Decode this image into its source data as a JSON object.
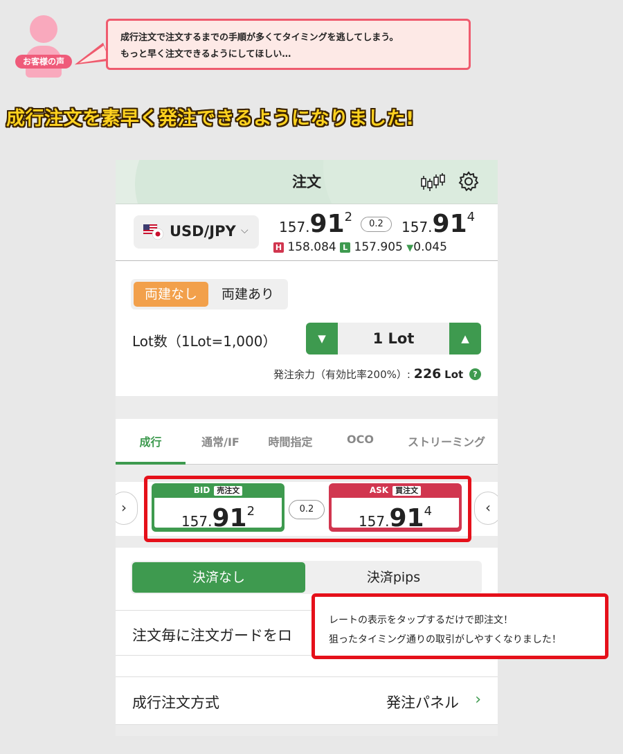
{
  "voice": {
    "badge": "お客様の声",
    "line1": "成行注文で注文するまでの手順が多くてタイミングを逃してしまう。",
    "line2": "もっと早く注文できるようにしてほしい…"
  },
  "headline": "成行注文を素早く発注できるようになりました!",
  "app": {
    "title": "注文",
    "chart_icon": "candlestick-icon",
    "settings_icon": "gear-icon"
  },
  "rate": {
    "pair": "USD/JPY",
    "bid_small": "157.",
    "bid_big": "91",
    "bid_sup": "2",
    "spread": "0.2",
    "ask_small": "157.",
    "ask_big": "91",
    "ask_sup": "4",
    "high_badge": "H",
    "high": "158.084",
    "low_badge": "L",
    "low": "157.905",
    "change_arrow": "▼",
    "change": "0.045"
  },
  "order": {
    "hedge_off": "両建なし",
    "hedge_on": "両建あり",
    "lot_label": "Lot数（1Lot=1,000）",
    "lot_minus": "▼",
    "lot_value": "1 Lot",
    "lot_plus": "▲",
    "margin_label": "発注余力（有効比率200%）:",
    "margin_value": "226",
    "margin_unit": "Lot",
    "help": "?"
  },
  "tabs": [
    "成行",
    "通常/IF",
    "時間指定",
    "OCO",
    "ストリーミング"
  ],
  "quote": {
    "left_arrow": "›",
    "right_arrow": "‹",
    "bid_label": "BID",
    "bid_tag": "売注文",
    "bid_small": "157.",
    "bid_big": "91",
    "bid_sup": "2",
    "spread": "0.2",
    "ask_label": "ASK",
    "ask_tag": "買注文",
    "ask_small": "157.",
    "ask_big": "91",
    "ask_sup": "4"
  },
  "settle": {
    "none": "決済なし",
    "pips": "決済pips",
    "guard_label": "注文毎に注文ガードをロ"
  },
  "method": {
    "label": "成行注文方式",
    "value": "発注パネル",
    "chev": "›"
  },
  "callout": {
    "line1": "レートの表示をタップするだけで即注文！",
    "line2": "狙ったタイミング通りの取引がしやすくなりました！"
  },
  "colors": {
    "green": "#3e9a4f",
    "red": "#d1364f",
    "orange": "#f2a04b",
    "highlight_red": "#e5101a"
  }
}
